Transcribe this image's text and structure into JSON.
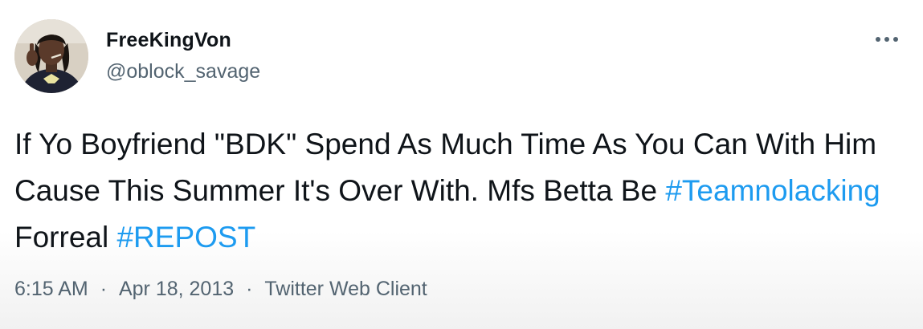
{
  "author": {
    "display_name": "FreeKingVon",
    "handle": "@oblock_savage",
    "avatar_icon": "profile-photo"
  },
  "more_icon": "more-options-icon",
  "tweet": {
    "text_part1": "If Yo Boyfriend \"BDK\" Spend As Much Time As You Can With Him Cause This Summer It's Over With. Mfs Betta Be ",
    "hashtag1": "#Teamnolacking",
    "text_part2": " Forreal ",
    "hashtag2": "#REPOST"
  },
  "meta": {
    "time": "6:15 AM",
    "separator": "·",
    "date": "Apr 18, 2013",
    "source": "Twitter Web Client"
  },
  "colors": {
    "text": "#0f1419",
    "secondary": "#536471",
    "link": "#1d9bf0"
  }
}
